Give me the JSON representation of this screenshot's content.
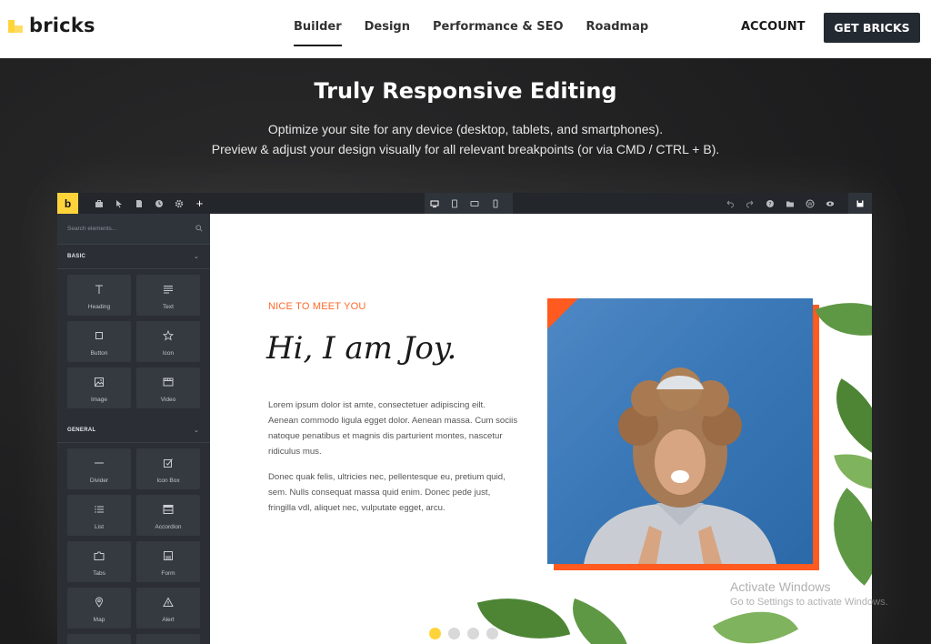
{
  "nav": {
    "logo_text": "bricks",
    "menu": [
      {
        "label": "Builder",
        "active": true
      },
      {
        "label": "Design",
        "active": false
      },
      {
        "label": "Performance & SEO",
        "active": false
      },
      {
        "label": "Roadmap",
        "active": false
      }
    ],
    "account_label": "ACCOUNT",
    "cta_label": "GET BRICKS"
  },
  "hero": {
    "title": "Truly Responsive Editing",
    "subtitle_lines": [
      "Optimize your site for any device (desktop, tablets, and smartphones).",
      "Preview & adjust your design visually for all relevant breakpoints (or via CMD / CTRL + B)."
    ]
  },
  "builder": {
    "logo_letter": "b",
    "search_placeholder": "Search elements...",
    "categories": [
      {
        "name": "BASIC",
        "elements": [
          {
            "label": "Heading",
            "icon": "heading-icon"
          },
          {
            "label": "Text",
            "icon": "text-icon"
          },
          {
            "label": "Button",
            "icon": "button-icon"
          },
          {
            "label": "Icon",
            "icon": "star-icon"
          },
          {
            "label": "Image",
            "icon": "image-icon"
          },
          {
            "label": "Video",
            "icon": "video-icon"
          }
        ]
      },
      {
        "name": "GENERAL",
        "elements": [
          {
            "label": "Divider",
            "icon": "divider-icon"
          },
          {
            "label": "Icon Box",
            "icon": "icon-box-icon"
          },
          {
            "label": "List",
            "icon": "list-icon"
          },
          {
            "label": "Accordion",
            "icon": "accordion-icon"
          },
          {
            "label": "Tabs",
            "icon": "tabs-icon"
          },
          {
            "label": "Form",
            "icon": "form-icon"
          },
          {
            "label": "Map",
            "icon": "map-pin-icon"
          },
          {
            "label": "Alert",
            "icon": "alert-icon"
          }
        ]
      }
    ],
    "canvas": {
      "eyebrow": "NICE TO MEET YOU",
      "heading": "Hi, I am Joy.",
      "paragraph_1": [
        "Lorem ipsum dolor ist amte, consectetuer adipiscing eilt.",
        "Aenean commodo ligula egget dolor. Aenean massa. Cum sociis",
        "natoque penatibus et magnis dis parturient montes, nascetur",
        "ridiculus mus."
      ],
      "paragraph_2": [
        "Donec quak felis, ultricies nec, pellentesque eu, pretium quid,",
        "sem. Nulls consequat massa quid enim. Donec pede just,",
        "fringilla vdl, aliquet nec, vulputate egget, arcu."
      ]
    }
  },
  "watermark": {
    "line1": "Activate Windows",
    "line2": "Go to Settings to activate Windows."
  },
  "carousel": {
    "count": 4,
    "active_index": 0
  },
  "colors": {
    "accent_yellow": "#ffd43b",
    "accent_orange": "#ff6a2b",
    "builder_dark": "#23262b",
    "cta_dark": "#232a32"
  }
}
